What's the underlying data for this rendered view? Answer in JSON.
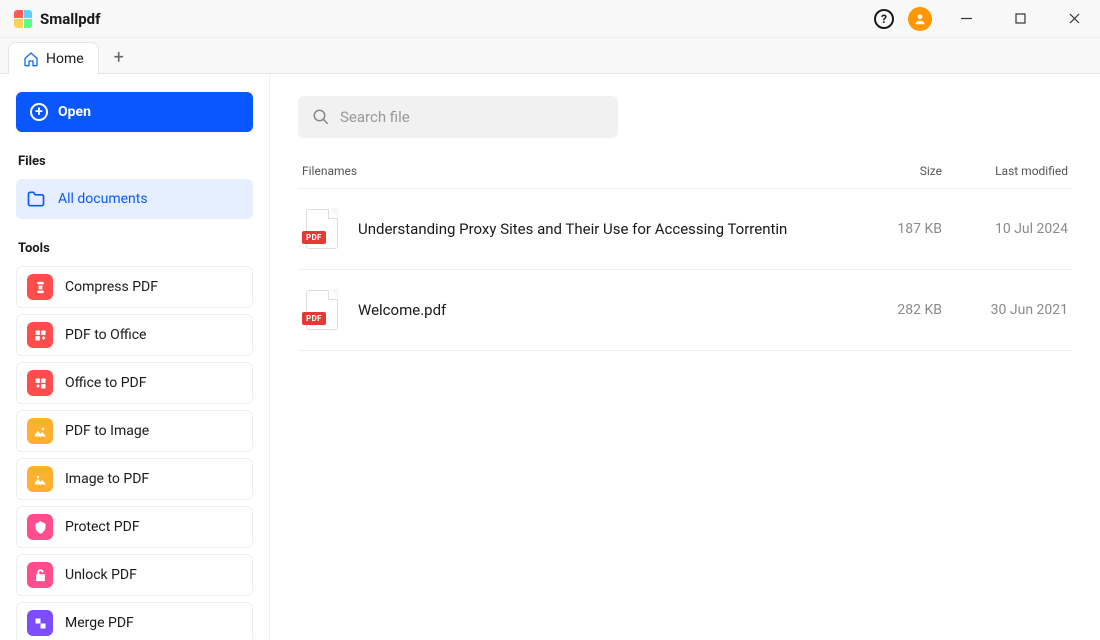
{
  "titlebar": {
    "app_name": "Smallpdf",
    "help_glyph": "?"
  },
  "tabs": {
    "home_label": "Home",
    "newtab_glyph": "+"
  },
  "sidebar": {
    "open_label": "Open",
    "files_label": "Files",
    "all_documents_label": "All documents",
    "tools_label": "Tools",
    "tools": [
      {
        "label": "Compress PDF",
        "color": "ic-red"
      },
      {
        "label": "PDF to Office",
        "color": "ic-red"
      },
      {
        "label": "Office to PDF",
        "color": "ic-red"
      },
      {
        "label": "PDF to Image",
        "color": "ic-yellow"
      },
      {
        "label": "Image to PDF",
        "color": "ic-yellow"
      },
      {
        "label": "Protect PDF",
        "color": "ic-pink"
      },
      {
        "label": "Unlock PDF",
        "color": "ic-pink"
      },
      {
        "label": "Merge PDF",
        "color": "ic-purple"
      }
    ]
  },
  "main": {
    "search_placeholder": "Search file",
    "headers": {
      "filenames": "Filenames",
      "size": "Size",
      "modified": "Last modified"
    },
    "pdf_badge": "PDF",
    "files": [
      {
        "name": "Understanding Proxy Sites and Their Use for Accessing Torrentin",
        "size": "187 KB",
        "date": "10 Jul 2024"
      },
      {
        "name": "Welcome.pdf",
        "size": "282 KB",
        "date": "30 Jun 2021"
      }
    ]
  }
}
